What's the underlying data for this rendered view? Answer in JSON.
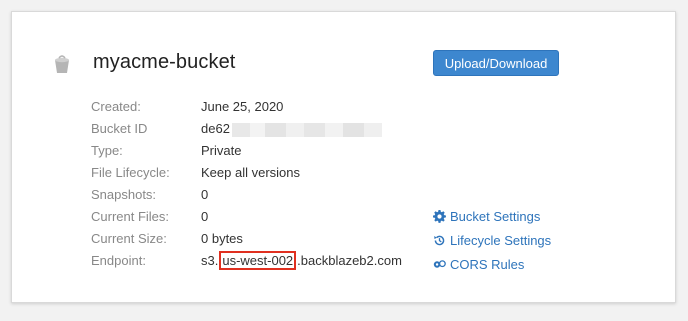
{
  "bucket": {
    "name": "myacme-bucket",
    "upload_label": "Upload/Download",
    "fields": [
      {
        "label": "Created:",
        "value": "June 25, 2020"
      },
      {
        "label": "Bucket ID",
        "value": "de62"
      },
      {
        "label": "Type:",
        "value": "Private"
      },
      {
        "label": "File Lifecycle:",
        "value": "Keep all versions"
      },
      {
        "label": "Snapshots:",
        "value": "0"
      },
      {
        "label": "Current Files:",
        "value": "0"
      },
      {
        "label": "Current Size:",
        "value": "0 bytes"
      },
      {
        "label": "Endpoint:",
        "value_prefix": "s3.",
        "value_highlight": "us-west-002",
        "value_suffix": ".backblazeb2.com"
      }
    ],
    "links": [
      {
        "label": "Bucket Settings",
        "icon": "gear-icon"
      },
      {
        "label": "Lifecycle Settings",
        "icon": "history-icon"
      },
      {
        "label": "CORS Rules",
        "icon": "cors-icon"
      }
    ]
  },
  "colors": {
    "accent": "#3d87cf",
    "link": "#2e74bb",
    "highlight_border": "#e03020"
  }
}
